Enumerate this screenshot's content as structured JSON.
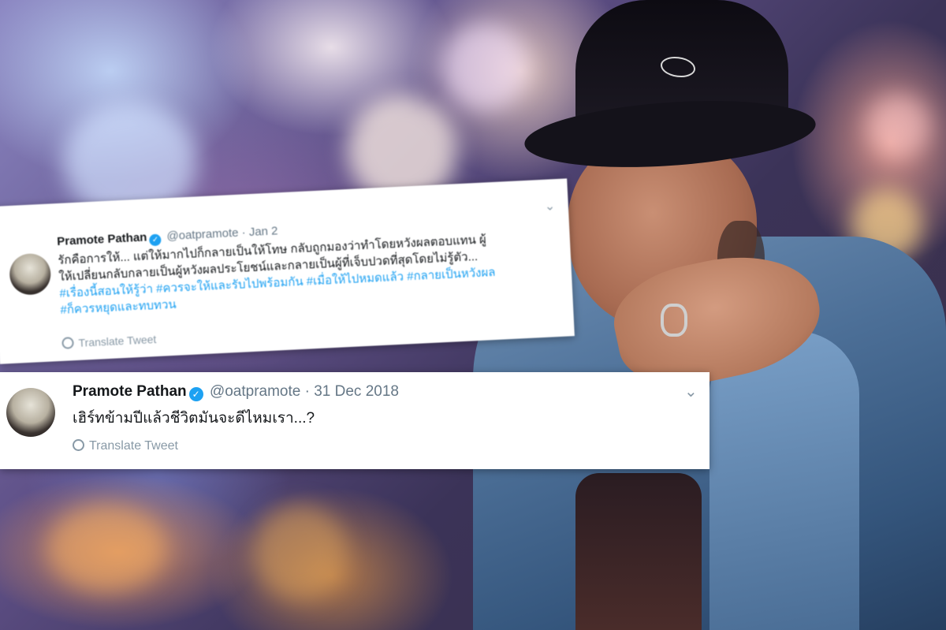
{
  "tweets": [
    {
      "name": "Pramote Pathan",
      "handle": "@oatpramote",
      "date": "· Jan 2",
      "text_line1": "รักคือการให้... แต่ให้มากไปก็กลายเป็นให้โทษ กลับถูกมองว่าทำโดยหวังผลตอบแทน ผู้",
      "text_line2": "ให้เปลี่ยนกลับกลายเป็นผู้หวังผลประโยชน์และกลายเป็นผู้ที่เจ็บปวดที่สุดโดยไม่รู้ตัว...",
      "hashtags_line1": "#เรื่องนี้สอนให้รู้ว่า #ควรจะให้และรับไปพร้อมกัน #เมื่อให้ไปหมดแล้ว #กลายเป็นหวังผล",
      "hashtags_line2": "#ก็ควรหยุดและทบทวน",
      "translate": "Translate Tweet"
    },
    {
      "name": "Pramote Pathan",
      "handle": "@oatpramote",
      "date": "· 31 Dec 2018",
      "text": "เฮิร์ทข้ามปีแล้วชีวิตมันจะดีไหมเรา...?",
      "translate": "Translate Tweet"
    }
  ],
  "colors": {
    "link": "#1da1f2",
    "verified": "#1da1f2"
  }
}
